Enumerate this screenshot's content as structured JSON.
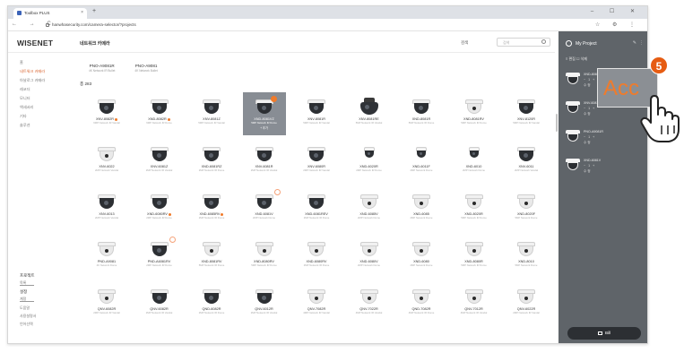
{
  "browser": {
    "tab_title": "Toolbox PLUS",
    "url": "hanwhasecurity.com/camera-selector/?projects",
    "new_tab": "+",
    "window_controls": "– ☐ ✕",
    "nav_buttons": "← → C",
    "right_icons": "☆ ⚙ ⋮"
  },
  "app": {
    "logo": "WISENET",
    "page_title": "네트워크 카메라",
    "filter_label": "검색",
    "search_placeholder": "검색"
  },
  "sidebar": {
    "items": [
      {
        "label": "홈",
        "active": false
      },
      {
        "label": "네트워크 카메라",
        "active": true
      },
      {
        "label": "아날로그 카메라",
        "active": false
      },
      {
        "label": "레코더",
        "active": false
      },
      {
        "label": "모니터",
        "active": false
      },
      {
        "label": "액세서리",
        "active": false
      },
      {
        "label": "기타",
        "active": false
      },
      {
        "label": "솔루션",
        "active": false
      }
    ],
    "bottom": [
      {
        "label": "프로젝트",
        "kind": "head"
      },
      {
        "label": "목록",
        "kind": "ul"
      },
      {
        "label": "설정",
        "kind": "head"
      },
      {
        "label": "계정",
        "kind": "ul"
      },
      {
        "label": "도움말",
        "kind": "item"
      },
      {
        "label": "사용설명서",
        "kind": "item"
      },
      {
        "label": "언어선택",
        "kind": "item"
      }
    ]
  },
  "main": {
    "model_tabs": [
      {
        "name": "PNO-A9081R",
        "sub": "4K Network IR Bullet"
      },
      {
        "name": "PNO-A9081",
        "sub": "4K Network Bullet"
      }
    ],
    "count_label": "총 283",
    "rows": [
      [
        {
          "name": "XNV-8082R",
          "desc": "6MP Network IR Vandal",
          "cam": "dark",
          "badge": "dot"
        },
        {
          "name": "XND-8082R",
          "desc": "6MP Network IR Dome",
          "cam": "dark",
          "badge": "dot"
        },
        {
          "name": "XNV-8081Z",
          "desc": "5MP Network IR Vandal",
          "cam": "dark",
          "badge": ""
        },
        {
          "name": "XND-8081VZ",
          "desc": "5MP Network IR Dome",
          "cam": "dark",
          "badge": "new",
          "selected": true,
          "add": "+ 추가"
        },
        {
          "name": "XNV-8081R",
          "desc": "5MP Network IR Vandal",
          "cam": "dark",
          "badge": ""
        },
        {
          "name": "XNV-8081RE",
          "desc": "5MP Network IR Vandal",
          "cam": "ptz",
          "badge": ""
        },
        {
          "name": "XND-8081R",
          "desc": "5MP Network IR Dome",
          "cam": "dark",
          "badge": ""
        },
        {
          "name": "XND-8081RV",
          "desc": "5MP Network IR Dome",
          "cam": "white",
          "badge": ""
        },
        {
          "name": "XNV-8120R",
          "desc": "5MP Network IR Vandal",
          "cam": "dark",
          "badge": ""
        }
      ],
      [
        {
          "name": "XNV-6022",
          "desc": "2MP Network Vandal",
          "cam": "white",
          "badge": ""
        },
        {
          "name": "XNV-6081Z",
          "desc": "2MP Network IR Vandal",
          "cam": "dark",
          "badge": ""
        },
        {
          "name": "XND-6081RZ",
          "desc": "2MP Network IR Dome",
          "cam": "dark",
          "badge": ""
        },
        {
          "name": "XNV-6081R",
          "desc": "2MP Network IR Vandal",
          "cam": "dark",
          "badge": ""
        },
        {
          "name": "XNV-6080R",
          "desc": "2MP Network IR Vandal",
          "cam": "dark",
          "badge": ""
        },
        {
          "name": "XND-6020R",
          "desc": "2MP Network IR Dome",
          "cam": "mini",
          "badge": ""
        },
        {
          "name": "XND-6011F",
          "desc": "2MP Network Dome",
          "cam": "mini",
          "badge": ""
        },
        {
          "name": "XND-6010",
          "desc": "2MP Network Dome",
          "cam": "mini",
          "badge": ""
        },
        {
          "name": "XNV-6011",
          "desc": "2MP Network Vandal",
          "cam": "dark",
          "badge": ""
        }
      ],
      [
        {
          "name": "XNV-6013",
          "desc": "2MP Network Vandal",
          "cam": "dark",
          "badge": ""
        },
        {
          "name": "XND-6080RV",
          "desc": "2MP Network IR Dome",
          "cam": "dark",
          "badge": "dot"
        },
        {
          "name": "XND-6085RV",
          "desc": "2MP Network IR Dome",
          "cam": "dark",
          "badge": "dot"
        },
        {
          "name": "XND-6081V",
          "desc": "2MP Network Dome",
          "cam": "dark",
          "badge": "ring"
        },
        {
          "name": "XND-6081REV",
          "desc": "2MP Network IR Dome",
          "cam": "dark",
          "badge": ""
        },
        {
          "name": "XND-6085V",
          "desc": "2MP Network Dome",
          "cam": "white",
          "badge": ""
        },
        {
          "name": "XND-6085",
          "desc": "2MP Network Dome",
          "cam": "white",
          "badge": ""
        },
        {
          "name": "XND-8020R",
          "desc": "5MP Network IR Dome",
          "cam": "white",
          "badge": ""
        },
        {
          "name": "XND-8020F",
          "desc": "5MP Network Dome",
          "cam": "white",
          "badge": ""
        }
      ],
      [
        {
          "name": "PND-A9081",
          "desc": "4K Network Dome",
          "cam": "white",
          "badge": ""
        },
        {
          "name": "PND-A6081RV",
          "desc": "2MP Network IR Dome",
          "cam": "dark",
          "badge": "ring"
        },
        {
          "name": "XND-8081RV",
          "desc": "5MP Network IR Dome",
          "cam": "white",
          "badge": ""
        },
        {
          "name": "XND-8080RV",
          "desc": "5MP Network IR Dome",
          "cam": "white",
          "badge": ""
        },
        {
          "name": "XND-6080RV",
          "desc": "2MP Network IR Dome",
          "cam": "white",
          "badge": ""
        },
        {
          "name": "XND-6080V",
          "desc": "2MP Network Dome",
          "cam": "white",
          "badge": ""
        },
        {
          "name": "XND-6080",
          "desc": "2MP Network Dome",
          "cam": "white",
          "badge": ""
        },
        {
          "name": "XND-8080R",
          "desc": "5MP Network IR Dome",
          "cam": "white",
          "badge": ""
        },
        {
          "name": "XND-8010",
          "desc": "5MP Network Dome",
          "cam": "white",
          "badge": ""
        }
      ],
      [
        {
          "name": "QNV-6082R",
          "desc": "2MP Network IR Vandal",
          "cam": "white",
          "badge": ""
        },
        {
          "name": "QNV-6082R",
          "desc": "2MP Network IR Vandal",
          "cam": "dark",
          "badge": ""
        },
        {
          "name": "QND-6082R",
          "desc": "2MP Network IR Dome",
          "cam": "dark",
          "badge": ""
        },
        {
          "name": "QNV-6012R",
          "desc": "2MP Network IR Vandal",
          "cam": "dark",
          "badge": ""
        },
        {
          "name": "QNV-7082R",
          "desc": "4MP Network IR Vandal",
          "cam": "white",
          "badge": ""
        },
        {
          "name": "QNV-7022R",
          "desc": "4MP Network IR Vandal",
          "cam": "white",
          "badge": ""
        },
        {
          "name": "QND-7082R",
          "desc": "4MP Network IR Dome",
          "cam": "white",
          "badge": ""
        },
        {
          "name": "QNV-7012R",
          "desc": "4MP Network IR Vandal",
          "cam": "white",
          "badge": ""
        },
        {
          "name": "QNV-6022R",
          "desc": "2MP Network IR Vandal",
          "cam": "white",
          "badge": ""
        }
      ]
    ]
  },
  "project_panel": {
    "title": "My Project",
    "edit_icon": "✎",
    "close_icon": "⋮",
    "toolbar": "≡ 편집   ☐ 삭제",
    "items": [
      {
        "name": "XND-8081VZ",
        "qty": "−  1  +",
        "note": "수정"
      },
      {
        "name": "XNV-6081R",
        "qty": "−  1  +",
        "note": "수정"
      },
      {
        "name": "PNO-A9081R",
        "qty": "−  1  +",
        "note": "수정"
      },
      {
        "name": "XND-6081V",
        "qty": "−  1  +",
        "note": "수정"
      }
    ],
    "footer_button": "Bill"
  },
  "overlay": {
    "step_number": "5",
    "popup_text": "Acc"
  },
  "colors": {
    "accent": "#e65c12",
    "panel": "#5f6469",
    "selected_cell": "#888d94"
  }
}
